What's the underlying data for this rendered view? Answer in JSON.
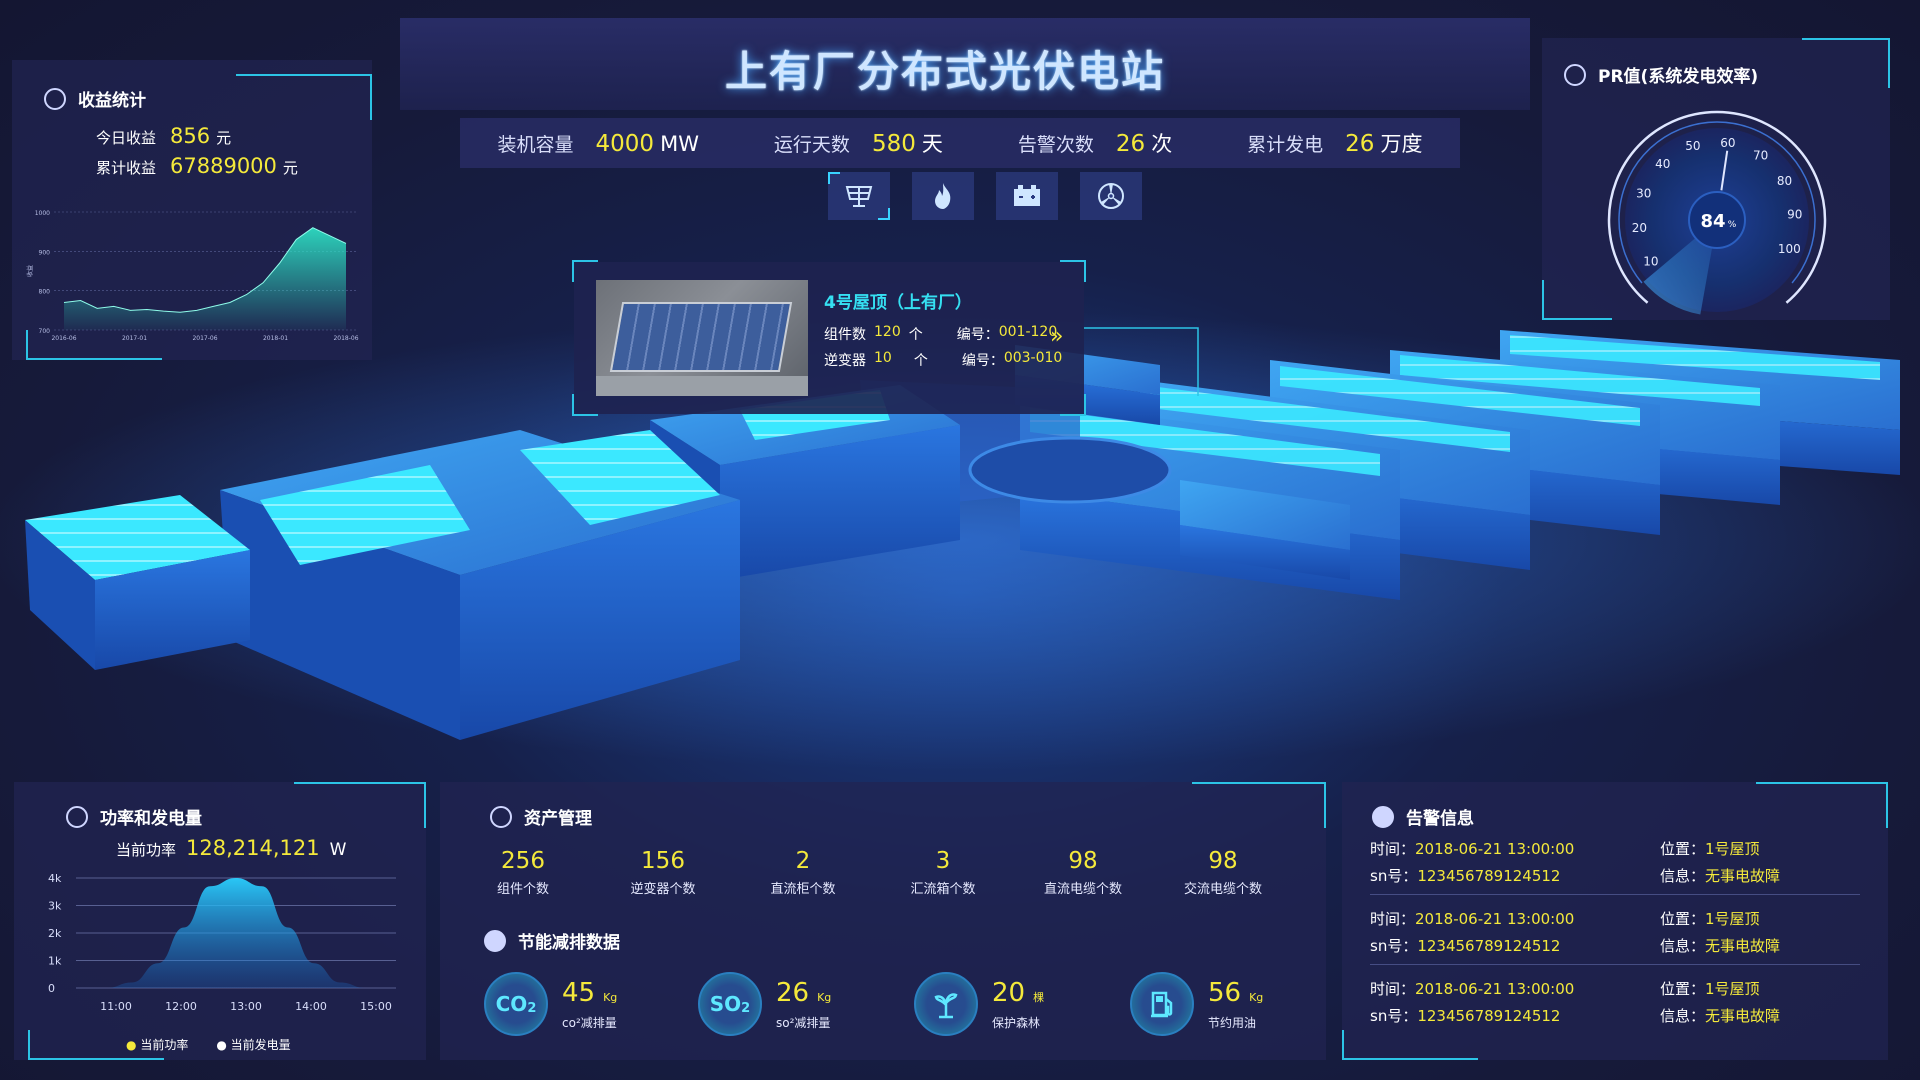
{
  "title": "上有厂分布式光伏电站",
  "stats": [
    {
      "label": "装机容量",
      "value": "4000",
      "unit": "MW"
    },
    {
      "label": "运行天数",
      "value": "580",
      "unit": "天"
    },
    {
      "label": "告警次数",
      "value": "26",
      "unit": "次"
    },
    {
      "label": "累计发电",
      "value": "26",
      "unit": "万度"
    }
  ],
  "mode_icons": [
    "solar-panel-icon",
    "fire-icon",
    "battery-icon",
    "wind-turbine-icon"
  ],
  "popup": {
    "title": "4号屋顶（上有厂）",
    "row1": {
      "label": "组件数",
      "value": "120",
      "unit": "个",
      "code_label": "编号：",
      "code": "001-120"
    },
    "row2": {
      "label": "逆变器",
      "value": "10",
      "unit": "个",
      "code_label": "编号：",
      "code": "003-010"
    }
  },
  "income": {
    "title": "收益统计",
    "today_label": "今日收益",
    "today_value": "856",
    "today_unit": "元",
    "total_label": "累计收益",
    "total_value": "67889000",
    "total_unit": "元",
    "chart_data": {
      "type": "area",
      "x": [
        "2016-06",
        "2017-01",
        "2017-06",
        "2018-01",
        "2018-06"
      ],
      "yticks": [
        "1000",
        "900",
        "800",
        "700"
      ],
      "ylabel": "收益",
      "ylim": [
        700,
        1000
      ],
      "values": [
        770,
        775,
        755,
        760,
        750,
        752,
        748,
        745,
        750,
        760,
        770,
        790,
        820,
        870,
        930,
        960,
        940,
        920
      ]
    }
  },
  "pr": {
    "title": "PR值(系统发电效率)",
    "value": "84",
    "unit": "%",
    "ticks": [
      "10",
      "20",
      "30",
      "40",
      "50",
      "60",
      "70",
      "80",
      "90",
      "100"
    ],
    "chart_data": {
      "type": "gauge",
      "value": 84,
      "min": 0,
      "max": 100
    }
  },
  "power": {
    "title": "功率和发电量",
    "current_label": "当前功率",
    "current_value": "128,214,121",
    "current_unit": "W",
    "legend": [
      "当前功率",
      "当前发电量"
    ],
    "chart_data": {
      "type": "area",
      "x": [
        "11:00",
        "12:00",
        "13:00",
        "14:00",
        "15:00"
      ],
      "yticks": [
        "4k",
        "3k",
        "2k",
        "1k",
        "0"
      ],
      "ylim": [
        0,
        4000
      ],
      "series": [
        {
          "name": "当前功率",
          "values": [
            0,
            200,
            900,
            2200,
            3700,
            4000,
            3700,
            2200,
            900,
            200,
            0
          ]
        }
      ]
    }
  },
  "assets": {
    "title": "资产管理",
    "items": [
      {
        "value": "256",
        "label": "组件个数"
      },
      {
        "value": "156",
        "label": "逆变器个数"
      },
      {
        "value": "2",
        "label": "直流柜个数"
      },
      {
        "value": "3",
        "label": "汇流箱个数"
      },
      {
        "value": "98",
        "label": "直流电缆个数"
      },
      {
        "value": "98",
        "label": "交流电缆个数"
      }
    ]
  },
  "eco": {
    "title": "节能减排数据",
    "items": [
      {
        "icon": "CO2",
        "value": "45",
        "unit": "Kg",
        "label": "co²减排量"
      },
      {
        "icon": "SO2",
        "value": "26",
        "unit": "Kg",
        "label": "so²减排量"
      },
      {
        "icon": "tree",
        "value": "20",
        "unit": "棵",
        "label": "保护森林"
      },
      {
        "icon": "fuel",
        "value": "56",
        "unit": "Kg",
        "label": "节约用油"
      }
    ]
  },
  "alarms": {
    "title": "告警信息",
    "items": [
      {
        "time_label": "时间：",
        "time": "2018-06-21  13:00:00",
        "sn_label": "sn号：",
        "sn": "123456789124512",
        "pos_label": "位置：",
        "pos": "1号屋顶",
        "info_label": "信息：",
        "info": "无事电故障"
      },
      {
        "time_label": "时间：",
        "time": "2018-06-21  13:00:00",
        "sn_label": "sn号：",
        "sn": "123456789124512",
        "pos_label": "位置：",
        "pos": "1号屋顶",
        "info_label": "信息：",
        "info": "无事电故障"
      },
      {
        "time_label": "时间：",
        "time": "2018-06-21  13:00:00",
        "sn_label": "sn号：",
        "sn": "123456789124512",
        "pos_label": "位置：",
        "pos": "1号屋顶",
        "info_label": "信息：",
        "info": "无事电故障"
      }
    ]
  }
}
